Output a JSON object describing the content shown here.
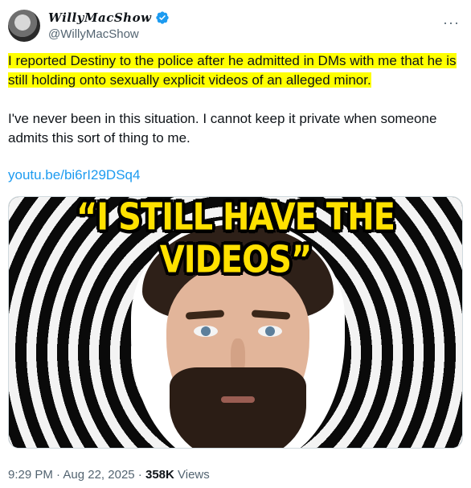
{
  "author": {
    "display_name": "WillyMacShow",
    "handle": "@WillyMacShow",
    "verified": true,
    "verified_color": "#1d9bf0"
  },
  "more_icon": "more-horizontal-icon",
  "tweet": {
    "paragraph1": "I reported Destiny to the police after he admitted in DMs with me that he is still holding onto sexually explicit videos of an alleged minor.",
    "paragraph1_highlight_color": "#ffff00",
    "paragraph2": "I've never been in this situation. I cannot keep it private when someone admits this sort of thing to me.",
    "link": "youtu.be/bi6rI29DSq4",
    "link_color": "#1d9bf0"
  },
  "media": {
    "caption": "“I STILL HAVE THE VIDEOS”",
    "caption_color": "#ffe100"
  },
  "footer": {
    "time": "9:29 PM",
    "separator1": " · ",
    "date": "Aug 22, 2025",
    "separator2": " · ",
    "views_count": "358K",
    "views_label": " Views"
  }
}
